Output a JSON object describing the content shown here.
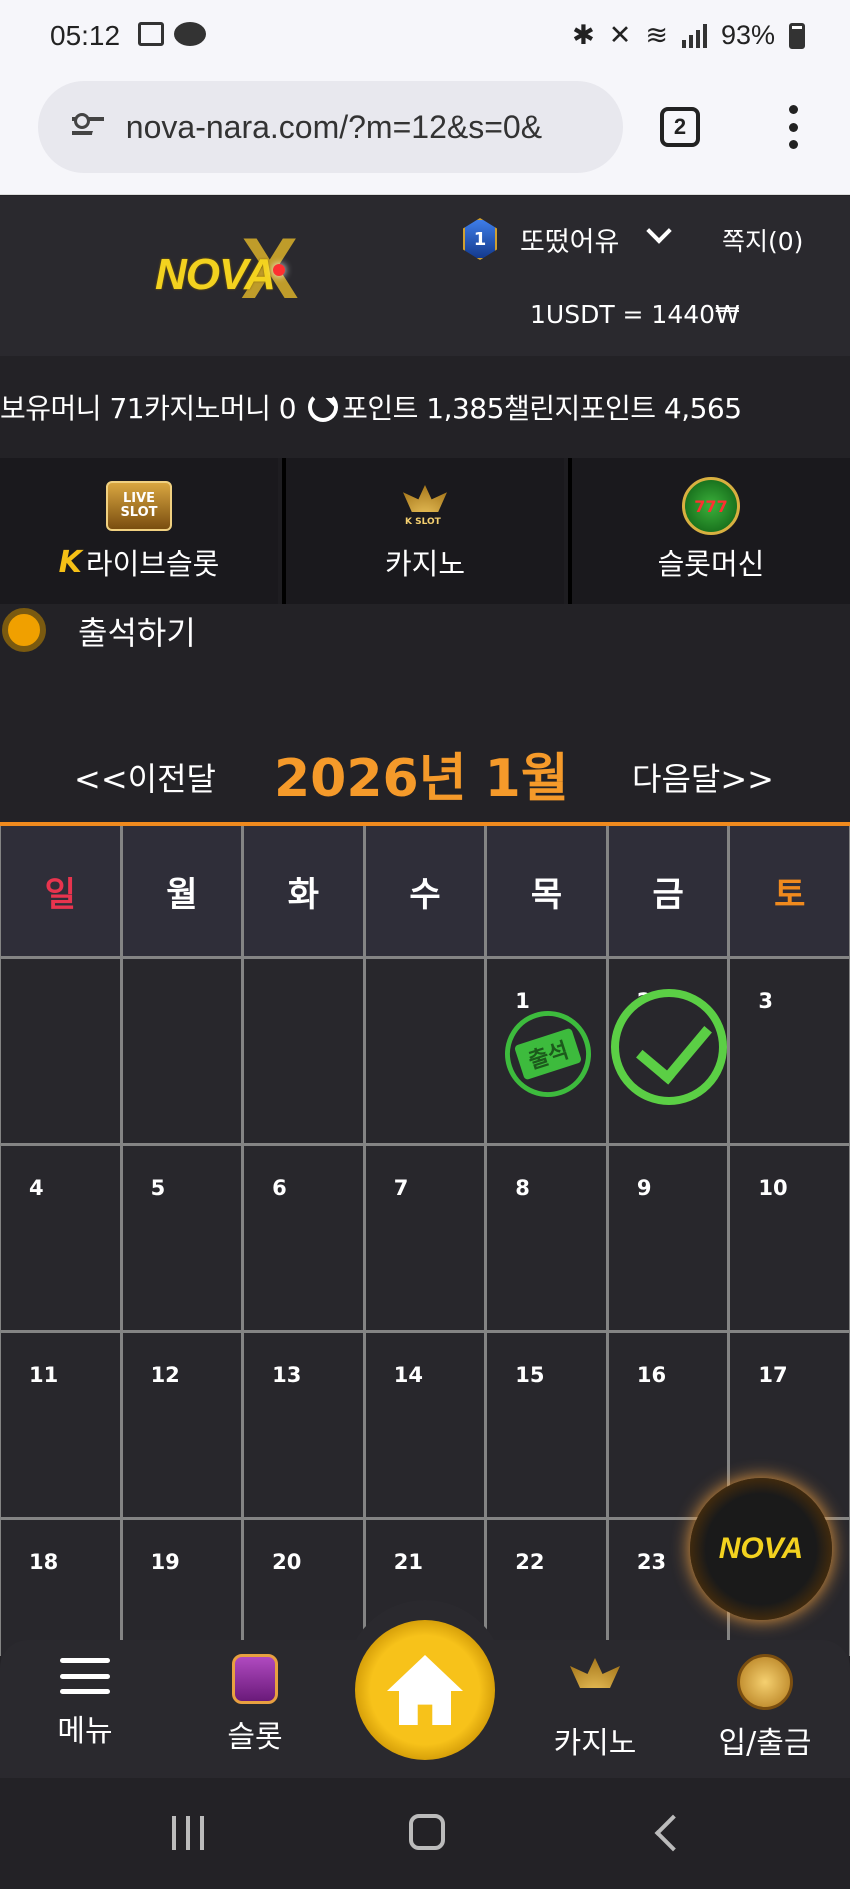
{
  "status_bar": {
    "time": "05:12",
    "battery": "93%"
  },
  "browser": {
    "url": "nova-nara.com/?m=12&s=0&",
    "tab_count": "2"
  },
  "header": {
    "logo_text": "NOVA",
    "rank_level": "1",
    "username": "또떴어유",
    "messages_label": "쪽지(0)",
    "exchange_rate": "1USDT = 1440₩"
  },
  "balances": {
    "holding_money": "보유머니 71",
    "casino_money": "카지노머니 0",
    "points": "포인트 1,385",
    "challenge_points": "챌린지포인트 4,565"
  },
  "categories": [
    {
      "label": "라이브슬롯",
      "icon": "live-slot-icon"
    },
    {
      "label": "카지노",
      "icon": "kslot-lotus-icon"
    },
    {
      "label": "슬롯머신",
      "icon": "777-slots-icon"
    }
  ],
  "attendance": {
    "title": "출석하기",
    "prev_label": "<<이전달",
    "month_title": "2026년 1월",
    "next_label": "다음달>>"
  },
  "calendar": {
    "weekdays": [
      "일",
      "월",
      "화",
      "수",
      "목",
      "금",
      "토"
    ],
    "stamp_label": "출석",
    "days": [
      {
        "num": "",
        "mark": ""
      },
      {
        "num": "",
        "mark": ""
      },
      {
        "num": "",
        "mark": ""
      },
      {
        "num": "",
        "mark": ""
      },
      {
        "num": "1",
        "mark": "stamp"
      },
      {
        "num": "2",
        "mark": "check"
      },
      {
        "num": "3",
        "mark": ""
      },
      {
        "num": "4",
        "mark": ""
      },
      {
        "num": "5",
        "mark": ""
      },
      {
        "num": "6",
        "mark": ""
      },
      {
        "num": "7",
        "mark": ""
      },
      {
        "num": "8",
        "mark": ""
      },
      {
        "num": "9",
        "mark": ""
      },
      {
        "num": "10",
        "mark": ""
      },
      {
        "num": "11",
        "mark": ""
      },
      {
        "num": "12",
        "mark": ""
      },
      {
        "num": "13",
        "mark": ""
      },
      {
        "num": "14",
        "mark": ""
      },
      {
        "num": "15",
        "mark": ""
      },
      {
        "num": "16",
        "mark": ""
      },
      {
        "num": "17",
        "mark": ""
      },
      {
        "num": "18",
        "mark": ""
      },
      {
        "num": "19",
        "mark": ""
      },
      {
        "num": "20",
        "mark": ""
      },
      {
        "num": "21",
        "mark": ""
      },
      {
        "num": "22",
        "mark": ""
      },
      {
        "num": "23",
        "mark": ""
      },
      {
        "num": "",
        "mark": ""
      }
    ]
  },
  "bottom_nav": {
    "menu": "메뉴",
    "slot": "슬롯",
    "casino": "카지노",
    "deposit": "입/출금"
  },
  "colors": {
    "accent_orange": "#f59a2a",
    "sunday_red": "#e8344e",
    "check_green": "#5bcf45",
    "home_gold": "#f7c21a"
  }
}
